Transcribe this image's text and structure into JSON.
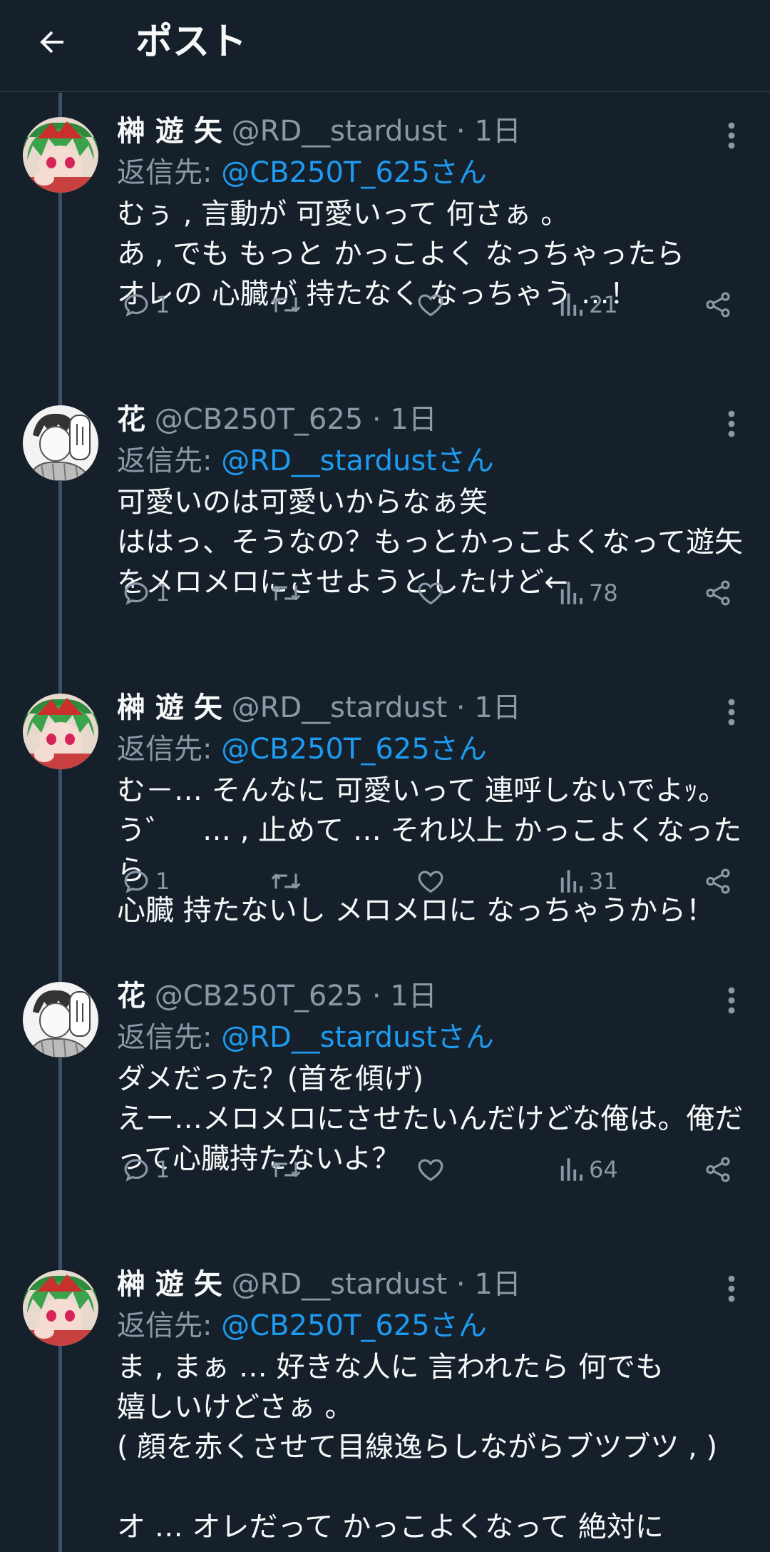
{
  "header": {
    "title": "ポスト"
  },
  "tweets": [
    {
      "author": "榊 遊 矢",
      "handle": "@RD__stardust",
      "time": "1日",
      "reply_label": "返信先:",
      "reply_to": "@CB250T_625さん",
      "text": "むぅ , 言動が 可愛いって 何さぁ 。\nあ , でも もっと かっこよく なっちゃったら\nオレの 心臓が 持たなく なっちゃう …！",
      "replies": "1",
      "views": "21",
      "avatar": "yuya"
    },
    {
      "author": "花",
      "handle": "@CB250T_625",
      "time": "1日",
      "reply_label": "返信先:",
      "reply_to": "@RD__stardustさん",
      "text": "可愛いのは可愛いからなぁ笑\nははっ、そうなの？もっとかっこよくなって遊矢をメロメロにさせようとしたけど←",
      "replies": "1",
      "views": "78",
      "avatar": "hana"
    },
    {
      "author": "榊 遊 矢",
      "handle": "@RD__stardust",
      "time": "1日",
      "reply_label": "返信先:",
      "reply_to": "@CB250T_625さん",
      "text": "む－… そんなに 可愛いって 連呼しないでよｯ。\nう゛　… , 止めて … それ以上 かっこよくなったら\n心臓 持たないし メロメロに なっちゃうから！",
      "replies": "1",
      "views": "31",
      "avatar": "yuya"
    },
    {
      "author": "花",
      "handle": "@CB250T_625",
      "time": "1日",
      "reply_label": "返信先:",
      "reply_to": "@RD__stardustさん",
      "text": "ダメだった？(首を傾げ)\nえー…メロメロにさせたいんだけどな俺は。俺だって心臓持たないよ？",
      "replies": "1",
      "views": "64",
      "avatar": "hana"
    },
    {
      "author": "榊 遊 矢",
      "handle": "@RD__stardust",
      "time": "1日",
      "reply_label": "返信先:",
      "reply_to": "@CB250T_625さん",
      "text": "ま , まぁ … 好きな人に 言われたら 何でも\n嬉しいけどさぁ 。\n( 顔を赤くさせて目線逸らしながらブツブツ , )\n\nオ … オレだって かっこよくなって 絶対に",
      "replies": "",
      "views": "",
      "avatar": "yuya"
    }
  ],
  "icons": {
    "back": "arrow-left-icon",
    "more": "more-vertical-icon",
    "reply": "reply-icon",
    "retweet": "retweet-icon",
    "like": "heart-icon",
    "views": "views-icon",
    "share": "share-icon"
  },
  "colors": {
    "background": "#15202b",
    "text": "#f7f9f9",
    "secondary": "#8b98a5",
    "link": "#1d9bf0",
    "divider": "#38444d"
  }
}
